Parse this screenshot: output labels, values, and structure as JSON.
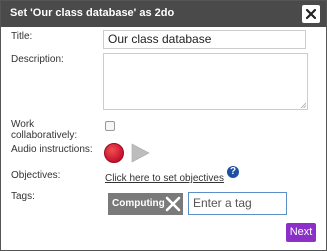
{
  "dialog": {
    "title": "Set 'Our class database' as 2do",
    "close_icon": "close-icon"
  },
  "form": {
    "title_label": "Title:",
    "title_value": "Our class database",
    "description_label": "Description:",
    "description_value": "",
    "collab_label_line1": "Work",
    "collab_label_line2": "collaboratively:",
    "collab_checked": false,
    "audio_label": "Audio instructions:",
    "record_icon": "record-icon",
    "play_icon": "play-icon",
    "objectives_label": "Objectives:",
    "objectives_link": "Click here to set objectives",
    "help_icon": "?",
    "tags_label": "Tags:",
    "tags": [
      {
        "label": "Computing"
      }
    ],
    "tag_placeholder": "Enter a tag"
  },
  "actions": {
    "next_label": "Next"
  },
  "colors": {
    "titlebar": "#4a4a4a",
    "record": "#c8102e",
    "next_button": "#8b2fc9",
    "help_icon": "#1f4fa3",
    "tag_chip": "#7a7a7a"
  }
}
